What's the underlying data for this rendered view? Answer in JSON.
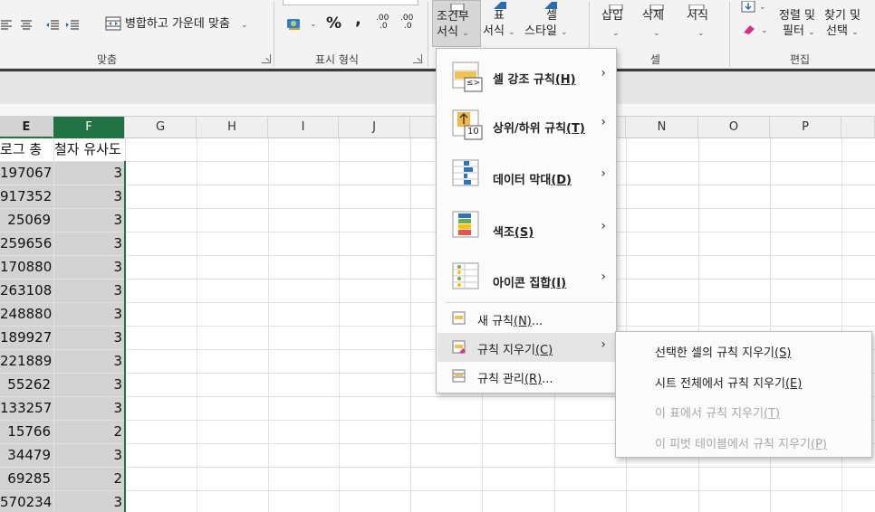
{
  "ribbon": {
    "merge_center": "병합하고 가운데 맞춤",
    "group_alignment": "맞춤",
    "group_number": "표시 형식",
    "group_cells": "셀",
    "group_editing": "편집",
    "percent": "%",
    "comma": ",",
    "conditional_format": [
      "조건부",
      "서식"
    ],
    "table_format": [
      "표",
      "서식"
    ],
    "cell_style": [
      "셀",
      "스타일"
    ],
    "insert": "삽입",
    "delete": "삭제",
    "format": "서식",
    "sort_filter": [
      "정렬 및",
      "필터"
    ],
    "find_select": [
      "찾기 및",
      "선택"
    ],
    "caret": "⌄",
    "dec_inc": ".00",
    "dec_dec": ".0"
  },
  "columns": [
    {
      "letter": "E",
      "state": "sel"
    },
    {
      "letter": "F",
      "state": "active"
    },
    {
      "letter": "G",
      "state": ""
    },
    {
      "letter": "H",
      "state": ""
    },
    {
      "letter": "I",
      "state": ""
    },
    {
      "letter": "J",
      "state": ""
    },
    {
      "letter": "N",
      "state": ""
    },
    {
      "letter": "O",
      "state": ""
    },
    {
      "letter": "P",
      "state": ""
    }
  ],
  "header_row": {
    "col_e": "로그 총",
    "col_f": "철자 유사도"
  },
  "rows": [
    {
      "e": "197067",
      "f": "3"
    },
    {
      "e": "917352",
      "f": "3"
    },
    {
      "e": "25069",
      "f": "3"
    },
    {
      "e": "259656",
      "f": "3"
    },
    {
      "e": "170880",
      "f": "3"
    },
    {
      "e": "263108",
      "f": "3"
    },
    {
      "e": "248880",
      "f": "3"
    },
    {
      "e": "189927",
      "f": "3"
    },
    {
      "e": "221889",
      "f": "3"
    },
    {
      "e": "55262",
      "f": "3"
    },
    {
      "e": "133257",
      "f": "3"
    },
    {
      "e": "15766",
      "f": "2"
    },
    {
      "e": "34479",
      "f": "3"
    },
    {
      "e": "69285",
      "f": "2"
    },
    {
      "e": "570234",
      "f": "3"
    }
  ],
  "menu": {
    "items": [
      {
        "label": "셀 강조 규칙",
        "key": "(H)",
        "icon": "highlight-cells-icon"
      },
      {
        "label": "상위/하위 규칙",
        "key": "(T)",
        "icon": "top-bottom-icon"
      },
      {
        "label": "데이터 막대",
        "key": "(D)",
        "icon": "data-bars-icon"
      },
      {
        "label": "색조",
        "key": "(S)",
        "icon": "color-scales-icon"
      },
      {
        "label": "아이콘 집합",
        "key": "(I)",
        "icon": "icon-sets-icon"
      }
    ],
    "new_rule": {
      "label": "새 규칙",
      "key": "(N)",
      "suffix": "..."
    },
    "clear_rules": {
      "label": "규칙 지우기",
      "key": "(C)"
    },
    "manage_rules": {
      "label": "규칙 관리",
      "key": "(R)",
      "suffix": "..."
    },
    "arrow": "›",
    "icon_ten": "10",
    "icon_le": "≤>"
  },
  "submenu": [
    {
      "label": "선택한 셀의 규칙 지우기",
      "key": "(S)",
      "enabled": true
    },
    {
      "label": "시트 전체에서 규칙 지우기",
      "key": "(E)",
      "enabled": true
    },
    {
      "label": "이 표에서 규칙 지우기",
      "key": "(T)",
      "enabled": false
    },
    {
      "label": "이 피벗 테이블에서 규칙 지우기",
      "key": "(P)",
      "enabled": false
    }
  ]
}
